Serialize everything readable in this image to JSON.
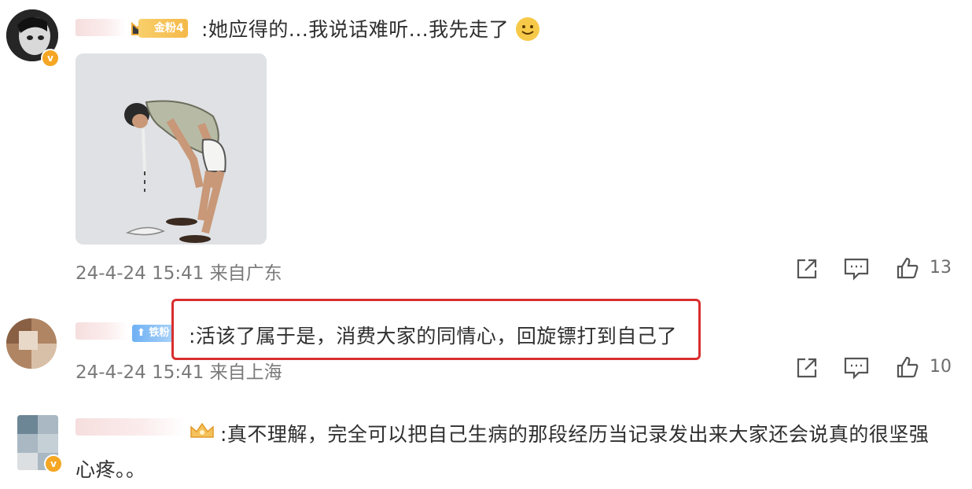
{
  "comments": [
    {
      "text": ":她应得的...我说话难听...我先走了",
      "emoji": "🙂",
      "badge": "金粉4",
      "timestamp": "24-4-24 15:41",
      "location": "来自广东",
      "likes": "13"
    },
    {
      "text": ":活该了属于是，消费大家的同情心，回旋镖打到自己了",
      "badge": "铁粉",
      "timestamp": "24-4-24 15:41",
      "location": "来自上海",
      "likes": "10"
    },
    {
      "text_line1": ":真不理解，完全可以把自己生病的那段经历当记录发出来大家还会说真的很坚强",
      "text_line2": "心疼。。"
    }
  ],
  "colors": {
    "highlight": "#d92e2e",
    "vip_badge": "#f5a623",
    "meta_text": "#7a7a7a"
  },
  "icons": {
    "share": "share-icon",
    "comment": "comment-icon",
    "like": "like-icon",
    "verified": "verified-badge-icon",
    "crown": "crown-icon"
  }
}
